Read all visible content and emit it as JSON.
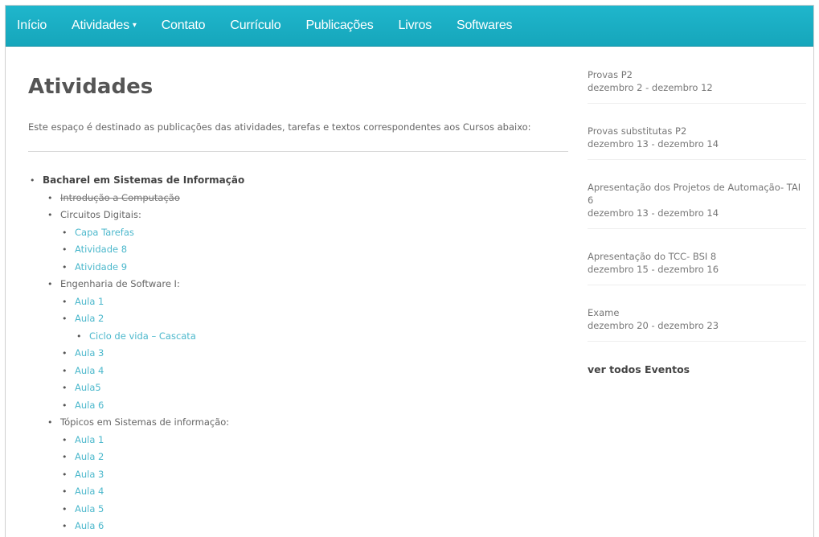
{
  "nav": {
    "items": [
      "Início",
      "Atividades",
      "Contato",
      "Currículo",
      "Publicações",
      "Livros",
      "Softwares"
    ],
    "dropdown_caret": "▾"
  },
  "main": {
    "title": "Atividades",
    "intro": "Este espaço é destinado as publicações das atividades, tarefas e textos correspondentes aos Cursos abaixo:",
    "course": "Bacharel em Sistemas de Informação",
    "intro_comp": "Introdução a Computação",
    "circuitos": {
      "label": "Circuitos Digitais:",
      "links": [
        "Capa Tarefas",
        "Atividade 8",
        "Atividade 9"
      ]
    },
    "engenharia": {
      "label": "Engenharia de Software I:",
      "aula1": "Aula 1",
      "aula2": "Aula 2",
      "aula2_sub": "Ciclo de vida – Cascata",
      "rest": [
        "Aula 3",
        "Aula 4",
        "Aula5",
        "Aula 6"
      ]
    },
    "topicos": {
      "label": "Tópicos em Sistemas de informação:",
      "links": [
        "Aula 1",
        "Aula 2",
        "Aula 3",
        "Aula 4",
        "Aula 5",
        "Aula 6"
      ]
    }
  },
  "sidebar": {
    "events": [
      {
        "title": "Provas P2",
        "date": "dezembro 2 - dezembro 12"
      },
      {
        "title": "Provas substitutas P2",
        "date": "dezembro 13 - dezembro 14"
      },
      {
        "title": "Apresentação dos Projetos de Automação- TAI 6",
        "date": "dezembro 13 - dezembro 14"
      },
      {
        "title": "Apresentação do TCC- BSI 8",
        "date": "dezembro 15 - dezembro 16"
      },
      {
        "title": "Exame",
        "date": "dezembro 20 - dezembro 23"
      }
    ],
    "see_all": "ver todos Eventos"
  },
  "colors": {
    "navbar": "#1fb6cc",
    "link": "#4cb8cc",
    "text": "#555555"
  }
}
